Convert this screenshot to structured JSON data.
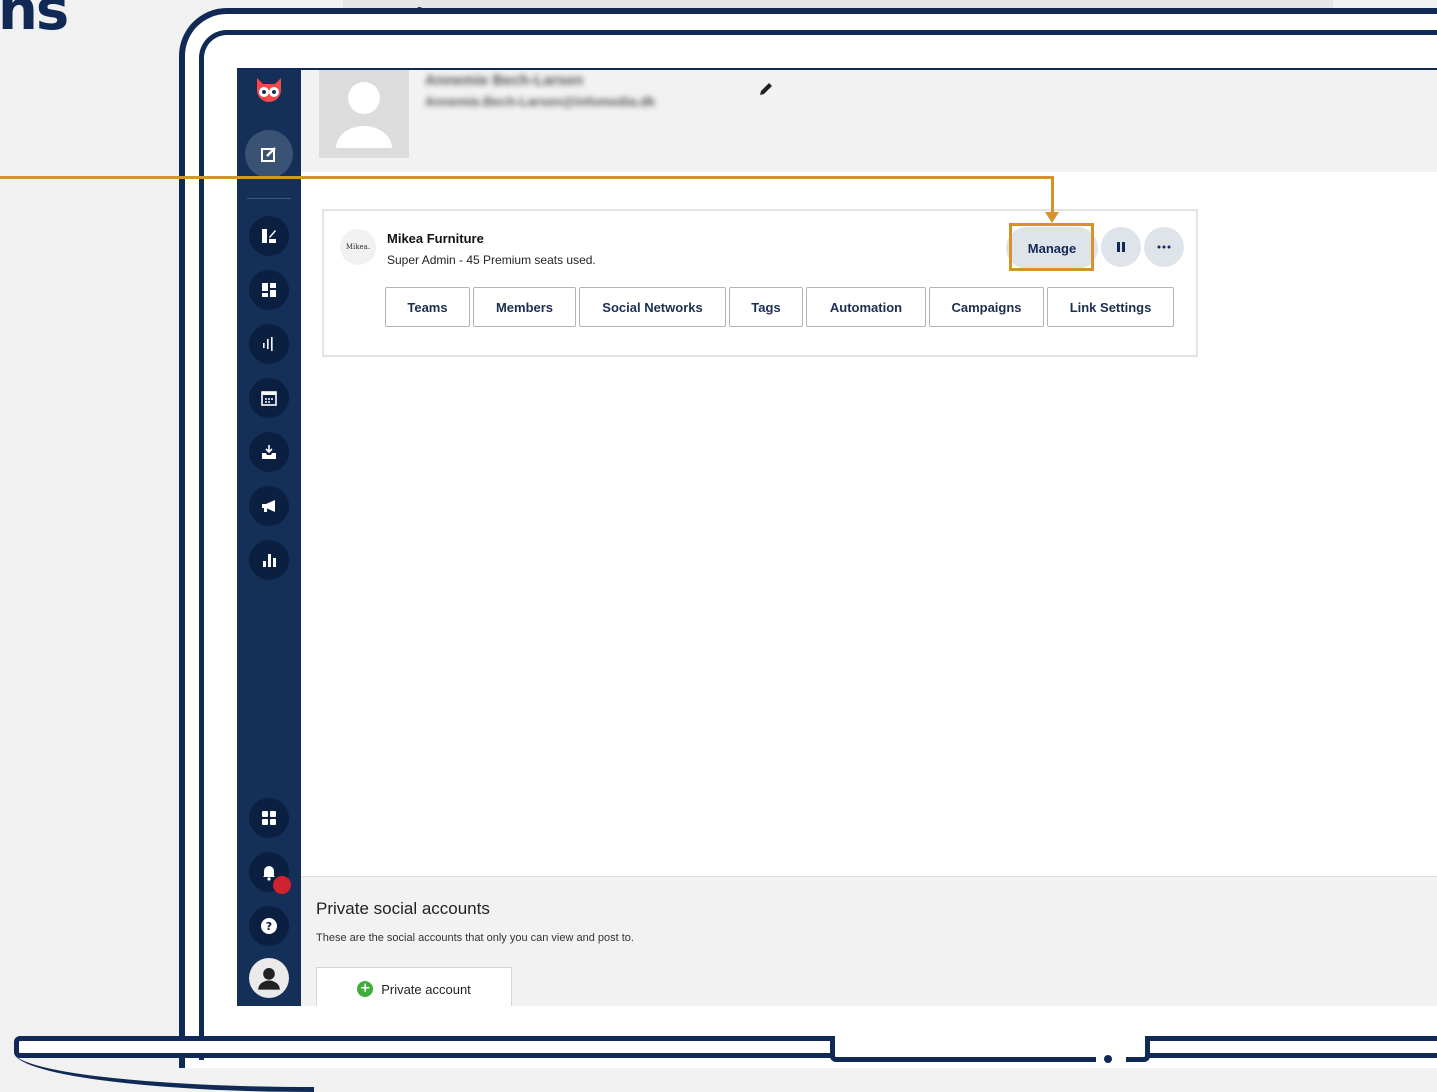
{
  "page_heading_fragment": "ns",
  "profile": {
    "name": "Annemie Bech-Larsen",
    "email": "Annemie.Bech-Larsen@infomedia.dk"
  },
  "organization": {
    "logo_text": "Mikea.",
    "name": "Mikea Furniture",
    "subtitle": "Super Admin - 45 Premium seats used.",
    "manage_label": "Manage",
    "pause_icon": "pause-icon",
    "more_icon": "ellipsis-icon",
    "tabs": [
      {
        "label": "Teams"
      },
      {
        "label": "Members"
      },
      {
        "label": "Social Networks"
      },
      {
        "label": "Tags"
      },
      {
        "label": "Automation"
      },
      {
        "label": "Campaigns"
      },
      {
        "label": "Link Settings"
      }
    ]
  },
  "private_section": {
    "title": "Private social accounts",
    "description": "These are the social accounts that only you can view and post to.",
    "button_label": "Private account"
  },
  "sidebar": {
    "icons": [
      "owl-logo-icon",
      "compose-icon",
      "streams-icon",
      "dashboard-icon",
      "analytics-bars-icon",
      "calendar-icon",
      "inbox-icon",
      "megaphone-icon",
      "reports-icon",
      "apps-icon",
      "bell-icon",
      "help-icon",
      "user-icon"
    ]
  },
  "colors": {
    "sidebar": "#143059",
    "accent_callout": "#d4932b",
    "frame": "#102a55"
  }
}
